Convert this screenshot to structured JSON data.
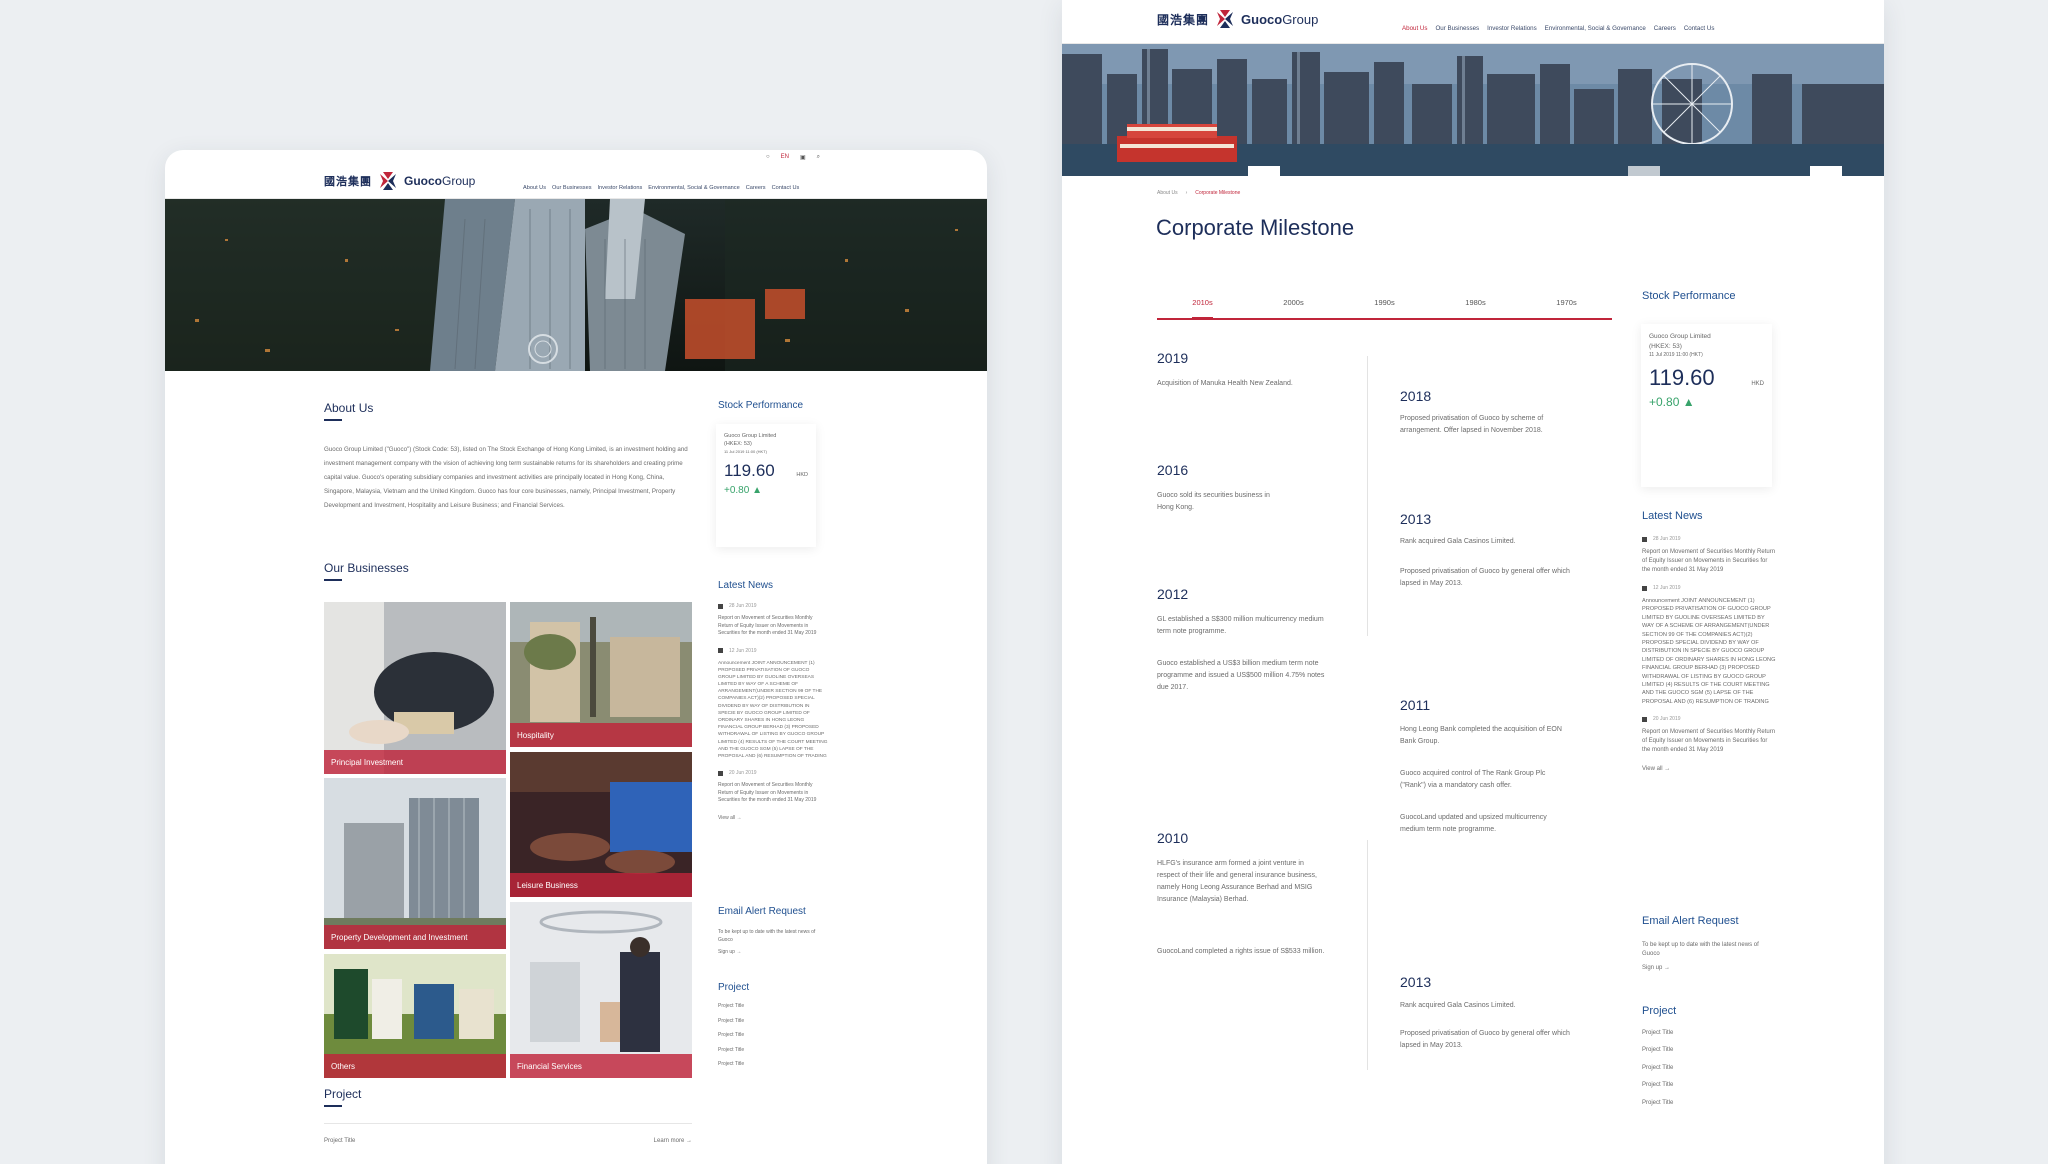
{
  "brand": {
    "name_cn": "國浩集團",
    "name_en_a": "Guoco",
    "name_en_b": "Group"
  },
  "nav": [
    "About Us",
    "Our Businesses",
    "Investor Relations",
    "Environmental, Social & Governance",
    "Careers",
    "Contact Us"
  ],
  "util": [
    "EN"
  ],
  "home": {
    "about_title": "About Us",
    "about_text": "Guoco Group Limited (\"Guoco\") (Stock Code: 53), listed on The Stock Exchange of Hong Kong Limited, is an investment holding and investment management company with the vision of achieving long term sustainable returns for its shareholders and creating prime capital value. Guoco's operating subsidiary companies and investment activities are principally located in Hong Kong, China, Singapore, Malaysia, Vietnam and the United Kingdom. Guoco has four core businesses, namely, Principal Investment, Property Development and Investment, Hospitality and Leisure Business; and Financial Services.",
    "businesses_title": "Our Businesses",
    "tiles": [
      "Principal Investment",
      "Hospitality",
      "Property Development and Investment",
      "Leisure Business",
      "Others",
      "Financial Services"
    ],
    "project_title": "Project",
    "project_row": "Project Title",
    "learn_more": "Learn more",
    "stock_title": "Stock Performance",
    "stock_name": "Guoco Group Limited",
    "stock_code": "(HKEX: 53)",
    "stock_time": "11 Jul 2019 11:00 (HKT)",
    "stock_price": "119.60",
    "stock_ccy": "HKD",
    "stock_change": "+0.80 ▲",
    "news_title": "Latest News",
    "news": [
      {
        "date": "28 Jun 2019",
        "text": "Report on Movement of Securities Monthly Return of Equity Issuer on Movements in Securities for the month ended 31 May 2019"
      },
      {
        "date": "12 Jun 2019",
        "text": "Announcement JOINT ANNOUNCEMENT (1) PROPOSED PRIVATISATION OF GUOCO GROUP LIMITED BY GUOLINE OVERSEAS LIMITED BY WAY OF A SCHEME OF ARRANGEMENT(UNDER SECTION 99 OF THE COMPANIES ACT)(2) PROPOSED SPECIAL DIVIDEND BY WAY OF DISTRIBUTION IN SPECIE BY GUOCO GROUP LIMITED OF ORDINARY SHARES IN HONG LEONG FINANCIAL GROUP BERHAD (3) PROPOSED WITHDRAWAL OF LISTING BY GUOCO GROUP LIMITED (4) RESULTS OF THE COURT MEETING AND THE GUOCO SGM (5) LAPSE OF THE PROPOSAL AND (6) RESUMPTION OF TRADING"
      },
      {
        "date": "20 Jun 2019",
        "text": "Report on Movement of Securities Monthly Return of Equity Issuer on Movements in Securities for the month ended 31 May 2019"
      }
    ],
    "view_all": "View all",
    "email_title": "Email Alert Request",
    "email_text": "To be kept up to date with the latest news of Guoco",
    "sign_up": "Sign up",
    "side_project_title": "Project",
    "side_projects": [
      "Project Title",
      "Project Title",
      "Project Title",
      "Project Title",
      "Project Title"
    ]
  },
  "milestone": {
    "breadcrumb_1": "About Us",
    "breadcrumb_2": "Corporate Milestone",
    "title": "Corporate Milestone",
    "tabs": [
      "2010s",
      "2000s",
      "1990s",
      "1980s",
      "1970s"
    ],
    "left": [
      {
        "year": "2019",
        "items": [
          "Acquisition of Manuka Health New Zealand."
        ]
      },
      {
        "year": "2016",
        "items": [
          "Guoco sold its securities business in Hong Kong."
        ]
      },
      {
        "year": "2012",
        "items": [
          "GL established a S$300 million multicurrency medium term note programme.",
          "Guoco established a US$3 billion medium term note programme and issued a US$500 million 4.75% notes due 2017."
        ]
      },
      {
        "year": "2010",
        "items": [
          "HLFG's insurance arm formed a joint venture in respect of their life and general insurance business, namely Hong Leong Assurance Berhad and MSIG Insurance (Malaysia) Berhad.",
          "GuocoLand completed a rights issue of S$533 million."
        ]
      }
    ],
    "right": [
      {
        "year": "2018",
        "items": [
          "Proposed privatisation of Guoco by scheme of arrangement. Offer lapsed in November 2018."
        ]
      },
      {
        "year": "2013",
        "items": [
          "Rank acquired Gala Casinos Limited.",
          "Proposed privatisation of Guoco by general offer which lapsed in May 2013."
        ]
      },
      {
        "year": "2011",
        "items": [
          "Hong Leong Bank completed the acquisition of EON Bank Group.",
          "Guoco acquired control of The Rank Group Plc (\"Rank\") via a mandatory cash offer.",
          "GuocoLand updated and upsized multicurrency medium term note programme."
        ]
      },
      {
        "year": "2013",
        "items": [
          "Rank acquired Gala Casinos Limited.",
          "Proposed privatisation of Guoco by general offer which lapsed in May 2013."
        ]
      }
    ]
  },
  "colors": {
    "brand_navy": "#1d2e5a",
    "accent_red": "#c0253a",
    "up_green": "#38a36b"
  }
}
